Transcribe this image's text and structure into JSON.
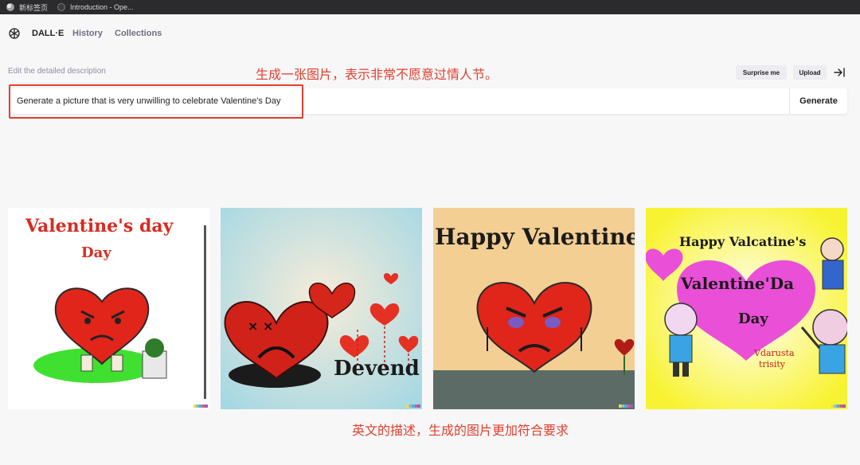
{
  "browser": {
    "tabs": [
      {
        "title": "新标签页"
      },
      {
        "title": "Introduction - Ope..."
      }
    ]
  },
  "nav": {
    "brand": "DALL·E",
    "history": "History",
    "collections": "Collections"
  },
  "editor": {
    "label": "Edit the detailed description",
    "prompt": "Generate a picture that is very unwilling to celebrate Valentine's Day",
    "generate": "Generate",
    "surprise": "Surprise me",
    "upload": "Upload"
  },
  "annotations": {
    "top": "生成一张图片，表示非常不愿意过情人节。",
    "bottom": "英文的描述，生成的图片更加符合要求"
  },
  "images": [
    {
      "line1": "Valentine's day",
      "line2": "Day"
    },
    {
      "caption": "Devend"
    },
    {
      "caption": "Happy Valentine Da"
    },
    {
      "line1": "Happy Valcatine's",
      "line2": "Valentine'Da",
      "line3": "Day",
      "line4": "Vdarusta",
      "line5": "trisity"
    }
  ],
  "colors": {
    "accent_red": "#e0402f",
    "heart_red": "#d92b1f",
    "tab_bar": "#2b2b2d"
  }
}
